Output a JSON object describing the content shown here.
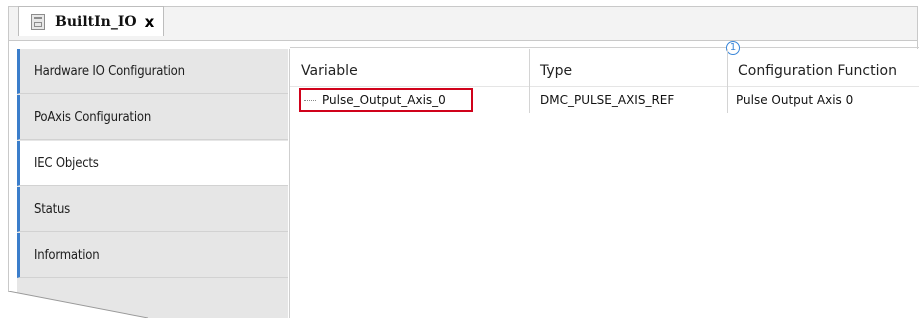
{
  "tab": {
    "title": "BuiltIn_IO",
    "close": "x"
  },
  "sidebar": {
    "items": [
      {
        "label": "Hardware IO Configuration"
      },
      {
        "label": "PoAxis Configuration"
      },
      {
        "label": "IEC Objects"
      },
      {
        "label": "Status"
      },
      {
        "label": "Information"
      }
    ],
    "active_index": 2
  },
  "table": {
    "badge": "1",
    "columns": [
      "Variable",
      "Type",
      "Configuration Function"
    ],
    "rows": [
      {
        "variable": "Pulse_Output_Axis_0",
        "type": "DMC_PULSE_AXIS_REF",
        "function": "Pulse Output Axis 0"
      }
    ]
  },
  "colors": {
    "accent": "#3b7ecb",
    "highlight_border": "#d0021b",
    "badge": "#3a86d8"
  },
  "icons": {
    "tab": "device-icon",
    "close": "close-icon"
  }
}
